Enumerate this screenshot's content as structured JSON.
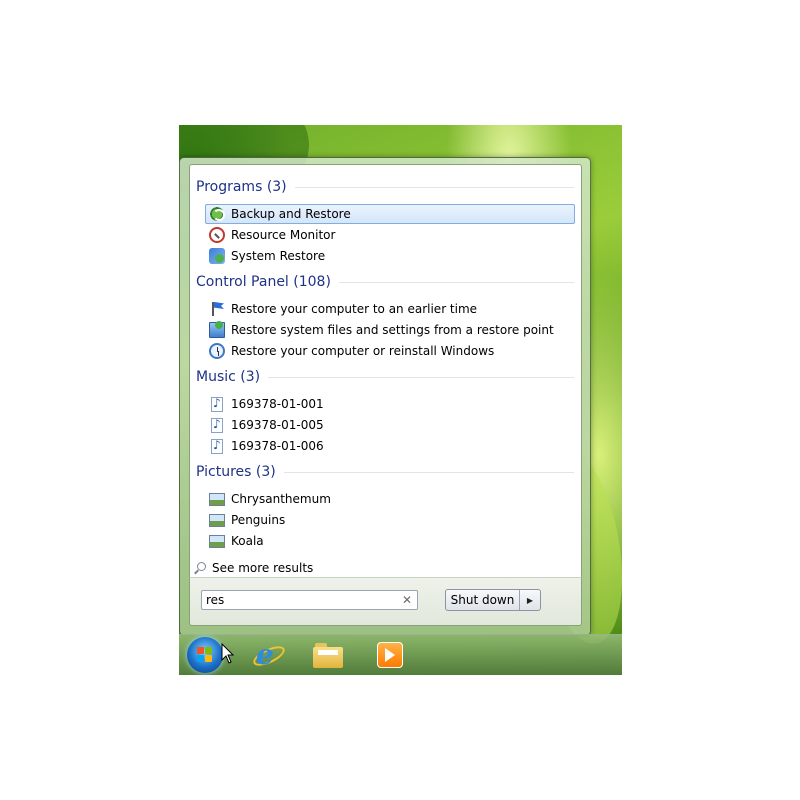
{
  "start_menu": {
    "groups": [
      {
        "title": "Programs (3)",
        "items": [
          {
            "label": "Backup and Restore",
            "icon": "backup-restore-icon",
            "selected": true
          },
          {
            "label": "Resource Monitor",
            "icon": "resource-monitor-icon"
          },
          {
            "label": "System Restore",
            "icon": "system-restore-icon"
          }
        ]
      },
      {
        "title": "Control Panel (108)",
        "items": [
          {
            "label": "Restore your computer to an earlier time",
            "icon": "flag-icon"
          },
          {
            "label": "Restore system files and settings from a restore point",
            "icon": "monitor-icon"
          },
          {
            "label": "Restore your computer or reinstall Windows",
            "icon": "recovery-clock-icon"
          }
        ]
      },
      {
        "title": "Music (3)",
        "items": [
          {
            "label": "169378-01-001",
            "icon": "music-file-icon"
          },
          {
            "label": "169378-01-005",
            "icon": "music-file-icon"
          },
          {
            "label": "169378-01-006",
            "icon": "music-file-icon"
          }
        ]
      },
      {
        "title": "Pictures (3)",
        "items": [
          {
            "label": "Chrysanthemum",
            "icon": "picture-file-icon"
          },
          {
            "label": "Penguins",
            "icon": "picture-file-icon"
          },
          {
            "label": "Koala",
            "icon": "picture-file-icon"
          }
        ]
      }
    ],
    "see_more": "See more results",
    "search": {
      "value": "res",
      "clear_icon": "close-icon"
    },
    "shutdown": {
      "label": "Shut down",
      "arrow_icon": "arrow-right-icon"
    }
  },
  "taskbar": {
    "icons": [
      "start-orb-icon",
      "internet-explorer-icon",
      "windows-explorer-icon",
      "media-player-icon"
    ]
  },
  "colors": {
    "group_title": "#1e3287",
    "selection_border": "#84acdd",
    "wallpaper": "#7cbb2c"
  }
}
